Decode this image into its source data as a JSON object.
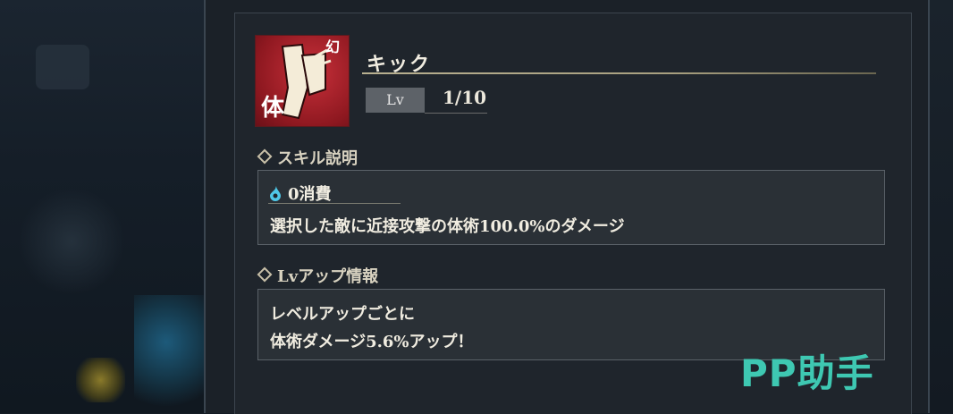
{
  "skill": {
    "name": "キック",
    "icon_label": "体",
    "level_label": "Lv",
    "level_value": "1/10"
  },
  "description": {
    "title": "スキル説明",
    "cost_text": "0消費",
    "text": "選択した敵に近接攻撃の体術100.0%のダメージ"
  },
  "level_up": {
    "title": "Lvアップ情報",
    "line1": "レベルアップごとに",
    "line2": "体術ダメージ5.6%アップ！"
  },
  "watermark": "PP助手",
  "colors": {
    "icon_bg": "#b8262f",
    "panel_bg": "#1f252c",
    "box_bg": "#2a3036",
    "cost_icon": "#4fc8e8",
    "watermark": "#3ec8b2"
  }
}
